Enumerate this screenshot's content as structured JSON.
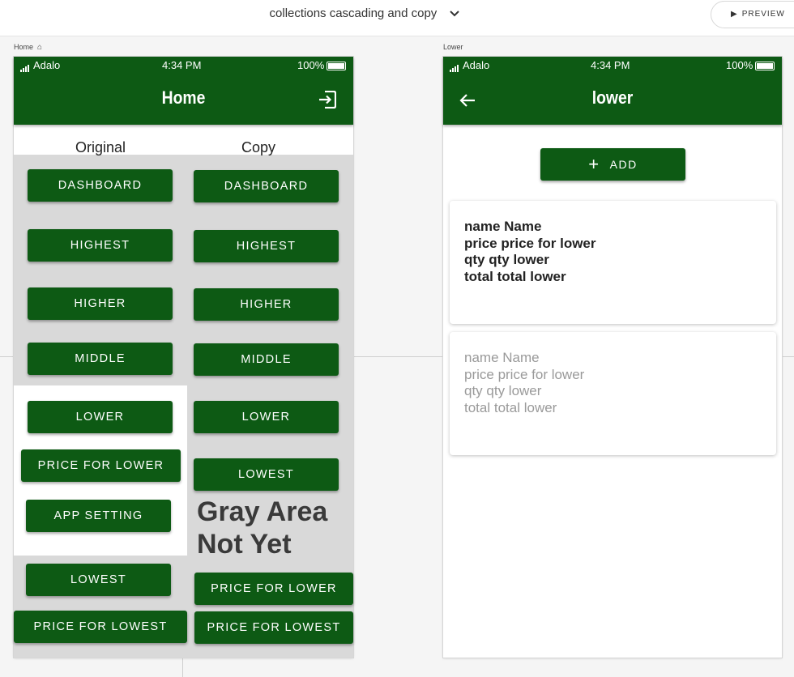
{
  "header": {
    "project_title": "collections cascading and copy",
    "preview_label": "PREVIEW"
  },
  "home_screen": {
    "label": "Home",
    "status": {
      "carrier": "Adalo",
      "time": "4:34 PM",
      "battery": "100%"
    },
    "title": "Home",
    "col_original": "Original",
    "col_copy": "Copy",
    "original_buttons": [
      "DASHBOARD",
      "HIGHEST",
      "HIGHER",
      "MIDDLE",
      "LOWER",
      "PRICE FOR LOWER",
      "APP SETTING",
      "LOWEST",
      "PRICE FOR LOWEST"
    ],
    "copy_buttons": [
      "DASHBOARD",
      "HIGHEST",
      "HIGHER",
      "MIDDLE",
      "LOWER",
      "LOWEST",
      "PRICE FOR LOWER",
      "PRICE FOR LOWEST"
    ],
    "note_line1": "Gray Area",
    "note_line2": "Not Yet"
  },
  "lower_screen": {
    "label": "Lower",
    "status": {
      "carrier": "Adalo",
      "time": "4:34 PM",
      "battery": "100%"
    },
    "title": "lower",
    "add_label": "ADD",
    "cards": [
      {
        "lines": [
          "name Name",
          "price price for lower",
          "qty qty lower",
          "total total lower"
        ]
      },
      {
        "lines": [
          "name Name",
          "price price for lower",
          "qty qty lower",
          "total total lower"
        ]
      }
    ]
  },
  "colors": {
    "primary": "#0d5a14",
    "gray_area": "#d9d9d9"
  },
  "icons": [
    "exit-icon",
    "back-arrow-icon",
    "home-icon",
    "plus-icon",
    "play-icon",
    "chevron-down-icon"
  ]
}
